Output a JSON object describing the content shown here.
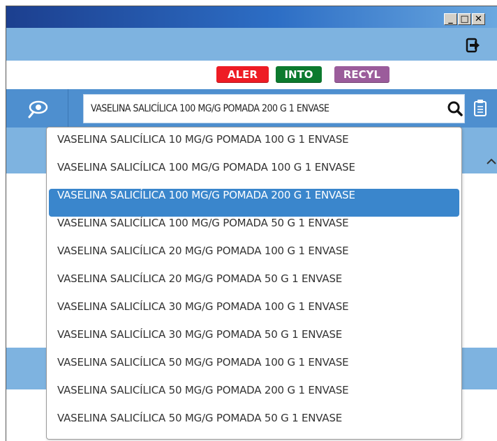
{
  "window": {
    "buttons": [
      "_",
      "□",
      "✕"
    ]
  },
  "toolbar": {
    "exit_icon": "exit-door-icon"
  },
  "badges": {
    "aler": "ALER",
    "into": "INTO",
    "recyl": "RECYL",
    "colors": {
      "aler": "#ee1c24",
      "into": "#0c7a2e",
      "recyl": "#9b5c9b"
    }
  },
  "search": {
    "value": "VASELINA SALICÍLICA 100 MG/G POMADA 200 G 1 ENVASE",
    "eye_icon": "eye-search-icon",
    "magnifier_icon": "magnifier-icon",
    "clipboard_icon": "clipboard-icon"
  },
  "dropdown": {
    "selected_index": 2,
    "items": [
      "VASELINA SALICÍLICA 10 MG/G POMADA 100 G 1 ENVASE",
      "VASELINA SALICÍLICA 100 MG/G POMADA 100 G 1 ENVASE",
      "VASELINA SALICÍLICA 100 MG/G POMADA 200 G 1 ENVASE",
      "VASELINA SALICÍLICA 100 MG/G POMADA 50 G 1 ENVASE",
      "VASELINA SALICÍLICA 20 MG/G POMADA 100 G 1 ENVASE",
      "VASELINA SALICÍLICA 20 MG/G POMADA 50 G 1 ENVASE",
      "VASELINA SALICÍLICA 30 MG/G POMADA 100 G 1 ENVASE",
      "VASELINA SALICÍLICA 30 MG/G POMADA 50 G 1 ENVASE",
      "VASELINA SALICÍLICA 50 MG/G POMADA 100 G 1 ENVASE",
      "VASELINA SALICÍLICA 50 MG/G POMADA 200 G 1 ENVASE",
      "VASELINA SALICÍLICA 50 MG/G POMADA 50 G 1 ENVASE"
    ]
  },
  "colors": {
    "toolbar": "#7eb3e0",
    "searchbar": "#4e8fcf",
    "selection": "#3a86cc"
  }
}
